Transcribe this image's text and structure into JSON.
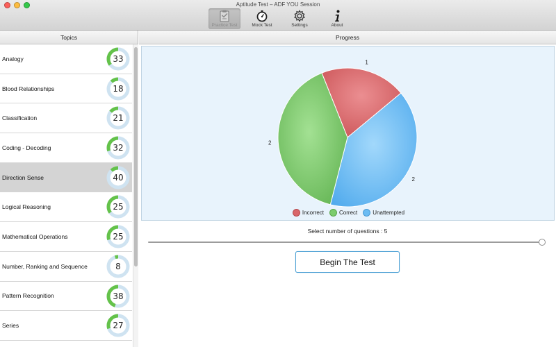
{
  "window": {
    "title": "Aptitude Test – ADF YOU Session"
  },
  "toolbar": {
    "items": [
      {
        "label": "Practice Test",
        "icon": "clipboard-icon",
        "active": true
      },
      {
        "label": "Mock Test",
        "icon": "stopwatch-icon",
        "active": false
      },
      {
        "label": "Settings",
        "icon": "gear-icon",
        "active": false
      },
      {
        "label": "About",
        "icon": "info-icon",
        "active": false
      }
    ]
  },
  "sidebar": {
    "header": "Topics",
    "topics": [
      {
        "name": "Analogy",
        "count": 33,
        "progress": 0.35
      },
      {
        "name": "Blood Relationships",
        "count": 18,
        "progress": 0.12
      },
      {
        "name": "Classification",
        "count": 21,
        "progress": 0.14
      },
      {
        "name": "Coding - Decoding",
        "count": 32,
        "progress": 0.3
      },
      {
        "name": "Direction Sense",
        "count": 40,
        "progress": 0.12,
        "selected": true
      },
      {
        "name": "Logical Reasoning",
        "count": 25,
        "progress": 0.35
      },
      {
        "name": "Mathematical Operations",
        "count": 25,
        "progress": 0.3
      },
      {
        "name": "Number, Ranking and Sequence",
        "count": 8,
        "progress": 0.05
      },
      {
        "name": "Pattern Recognition",
        "count": 38,
        "progress": 0.45
      },
      {
        "name": "Series",
        "count": 27,
        "progress": 0.3
      }
    ]
  },
  "main": {
    "header": "Progress",
    "slider_caption": "Select number of questions : 5",
    "slider_value": 5,
    "slider_fraction": 1.0,
    "begin_label": "Begin The Test"
  },
  "colors": {
    "incorrect": "#d9666a",
    "correct": "#7ccc6d",
    "unattempted": "#6cbcf3",
    "ring_progress": "#64c24a",
    "ring_track": "#cfe3f1"
  },
  "chart_data": {
    "type": "pie",
    "slices": [
      {
        "name": "Incorrect",
        "value": 1,
        "label": "1"
      },
      {
        "name": "Unattempted",
        "value": 2,
        "label": "2"
      },
      {
        "name": "Correct",
        "value": 2,
        "label": "2"
      }
    ],
    "legend": [
      "Incorrect",
      "Correct",
      "Unattempted"
    ],
    "legend_position": "bottom"
  }
}
